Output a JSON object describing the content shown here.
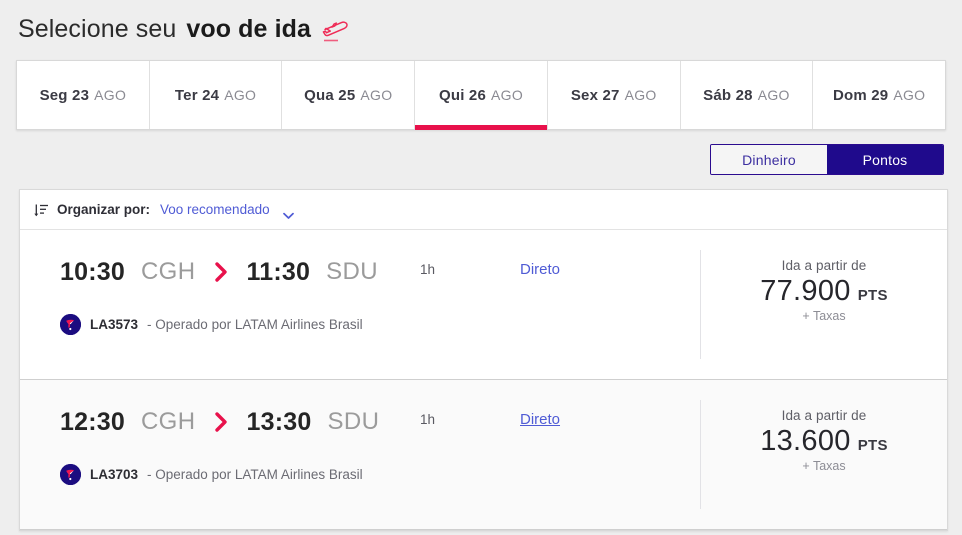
{
  "header": {
    "title_light": "Selecione seu",
    "title_bold": "voo de ida",
    "icon": "plane-takeoff-icon"
  },
  "date_tabs": [
    {
      "day": "Seg 23",
      "month": "AGO",
      "active": false
    },
    {
      "day": "Ter 24",
      "month": "AGO",
      "active": false
    },
    {
      "day": "Qua 25",
      "month": "AGO",
      "active": false
    },
    {
      "day": "Qui 26",
      "month": "AGO",
      "active": true
    },
    {
      "day": "Sex 27",
      "month": "AGO",
      "active": false
    },
    {
      "day": "Sáb 28",
      "month": "AGO",
      "active": false
    },
    {
      "day": "Dom 29",
      "month": "AGO",
      "active": false
    }
  ],
  "currency_toggle": {
    "cash_label": "Dinheiro",
    "points_label": "Pontos",
    "selected": "Pontos"
  },
  "sort_bar": {
    "icon": "sort-icon",
    "label": "Organizar por:",
    "value": "Voo recomendado",
    "chevron": "chevron-down-icon"
  },
  "flights": [
    {
      "depart_time": "10:30",
      "depart_code": "CGH",
      "arrive_time": "11:30",
      "arrive_code": "SDU",
      "duration": "1h",
      "stops": "Direto",
      "stops_underlined": false,
      "flight_number": "LA3573",
      "operator": "- Operado por LATAM Airlines Brasil",
      "price_from": "Ida a partir de",
      "price_amount": "77.900",
      "price_unit": "PTS",
      "price_taxes": "+ Taxas",
      "hover": false
    },
    {
      "depart_time": "12:30",
      "depart_code": "CGH",
      "arrive_time": "13:30",
      "arrive_code": "SDU",
      "duration": "1h",
      "stops": "Direto",
      "stops_underlined": true,
      "flight_number": "LA3703",
      "operator": "- Operado por LATAM Airlines Brasil",
      "price_from": "Ida a partir de",
      "price_amount": "13.600",
      "price_unit": "PTS",
      "price_taxes": "+ Taxas",
      "hover": true
    }
  ],
  "colors": {
    "accent_pink": "#e8114b",
    "brand_navy": "#1f0a8c",
    "link_blue": "#4f5bd5",
    "page_bg": "#eeeeee"
  }
}
